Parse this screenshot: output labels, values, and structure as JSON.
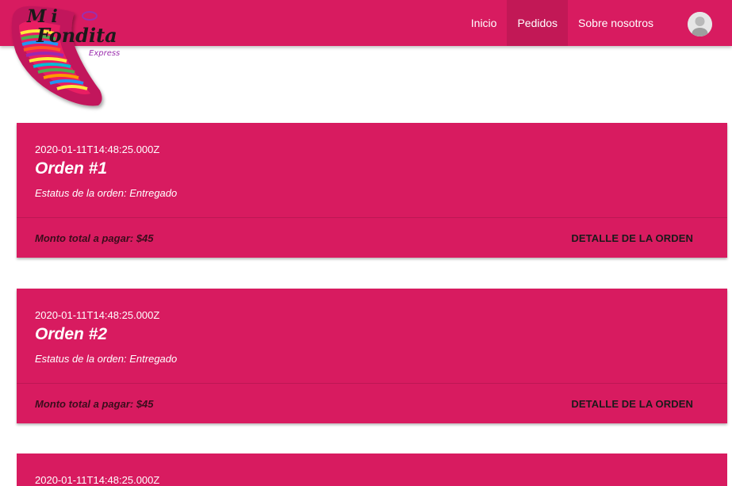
{
  "brand": {
    "line1": "Mi",
    "line2": "Fondita",
    "line3": "Express"
  },
  "nav": {
    "links": [
      {
        "label": "Inicio",
        "active": false
      },
      {
        "label": "Pedidos",
        "active": true
      },
      {
        "label": "Sobre nosotros",
        "active": false
      }
    ],
    "avatar_icon": "user-avatar-icon"
  },
  "colors": {
    "primary": "#d81b60",
    "white": "#ffffff"
  },
  "orders": [
    {
      "date": "2020-01-11T14:48:25.000Z",
      "title": "Orden #1",
      "status": "Estatus de la orden: Entregado",
      "total": "Monto total a pagar: $45",
      "action": "DETALLE DE LA ORDEN"
    },
    {
      "date": "2020-01-11T14:48:25.000Z",
      "title": "Orden #2",
      "status": "Estatus de la orden: Entregado",
      "total": "Monto total a pagar: $45",
      "action": "DETALLE DE LA ORDEN"
    },
    {
      "date": "2020-01-11T14:48:25.000Z"
    }
  ]
}
